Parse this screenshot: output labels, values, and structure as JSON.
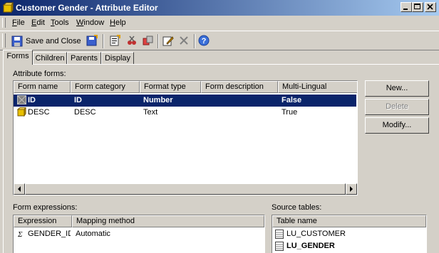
{
  "window": {
    "title": "Customer Gender - Attribute Editor"
  },
  "menu": {
    "items": [
      {
        "label": "File",
        "accel": "F"
      },
      {
        "label": "Edit",
        "accel": "E"
      },
      {
        "label": "Tools",
        "accel": "T"
      },
      {
        "label": "Window",
        "accel": "W"
      },
      {
        "label": "Help",
        "accel": "H"
      }
    ]
  },
  "toolbar": {
    "save_close_label": "Save and Close"
  },
  "tabs": [
    "Forms",
    "Children",
    "Parents",
    "Display"
  ],
  "attribute_forms": {
    "label": "Attribute forms:",
    "columns": [
      "Form name",
      "Form category",
      "Format type",
      "Form description",
      "Multi-Lingual"
    ],
    "rows": [
      {
        "name": "ID",
        "category": "ID",
        "format": "Number",
        "description": "",
        "multilingual": "False",
        "selected": true
      },
      {
        "name": "DESC",
        "category": "DESC",
        "format": "Text",
        "description": "",
        "multilingual": "True",
        "selected": false
      }
    ]
  },
  "buttons": {
    "new": "New...",
    "delete": "Delete",
    "modify": "Modify..."
  },
  "form_expressions": {
    "label": "Form expressions:",
    "columns": [
      "Expression",
      "Mapping method"
    ],
    "rows": [
      {
        "expression": "GENDER_ID",
        "mapping": "Automatic"
      }
    ]
  },
  "source_tables": {
    "label": "Source tables:",
    "columns": [
      "Table name"
    ],
    "rows": [
      {
        "name": "LU_CUSTOMER",
        "bold": false
      },
      {
        "name": "LU_GENDER",
        "bold": true
      }
    ]
  },
  "colors": {
    "titlebar_start": "#0a246a",
    "titlebar_end": "#a6caf0",
    "selection": "#0a246a",
    "face": "#d4d0c8"
  }
}
